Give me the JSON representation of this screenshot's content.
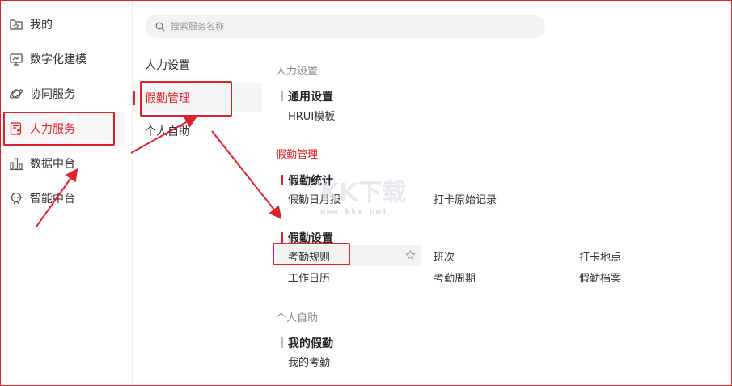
{
  "sidebar": {
    "items": [
      {
        "label": "我的",
        "icon": "folder-star-icon"
      },
      {
        "label": "数字化建模",
        "icon": "monitor-chart-icon"
      },
      {
        "label": "协同服务",
        "icon": "planet-icon"
      },
      {
        "label": "人力服务",
        "icon": "person-card-icon",
        "active": true
      },
      {
        "label": "数据中台",
        "icon": "bar-chart-icon"
      },
      {
        "label": "智能中台",
        "icon": "robot-icon"
      }
    ]
  },
  "search": {
    "placeholder": "搜索服务名称",
    "icon": "search-icon"
  },
  "middle": {
    "items": [
      {
        "label": "人力设置"
      },
      {
        "label": "假勤管理",
        "active": true
      },
      {
        "label": "个人自助"
      }
    ]
  },
  "content": {
    "sections": [
      {
        "title": "人力设置",
        "groups": [
          {
            "title": "通用设置",
            "links": [
              "HRUI模板"
            ]
          }
        ]
      },
      {
        "title": "假勤管理",
        "groups": [
          {
            "title": "假勤统计",
            "links": [
              "假勤日月报",
              "打卡原始记录"
            ]
          },
          {
            "title": "假勤设置",
            "links": [
              "考勤规则",
              "班次",
              "打卡地点",
              "工作日历",
              "考勤周期",
              "假勤档案"
            ]
          }
        ]
      },
      {
        "title": "个人自助",
        "groups": [
          {
            "title": "我的假勤",
            "links": [
              "我的考勤"
            ]
          }
        ]
      }
    ]
  },
  "watermark": {
    "text": "KK下载",
    "url": "www.kkx.net"
  },
  "colors": {
    "accent": "#e3202a",
    "sidebar_active_bg": "#f6f6f6",
    "search_bg": "#f2f2f4",
    "divider": "#eeeeee"
  }
}
